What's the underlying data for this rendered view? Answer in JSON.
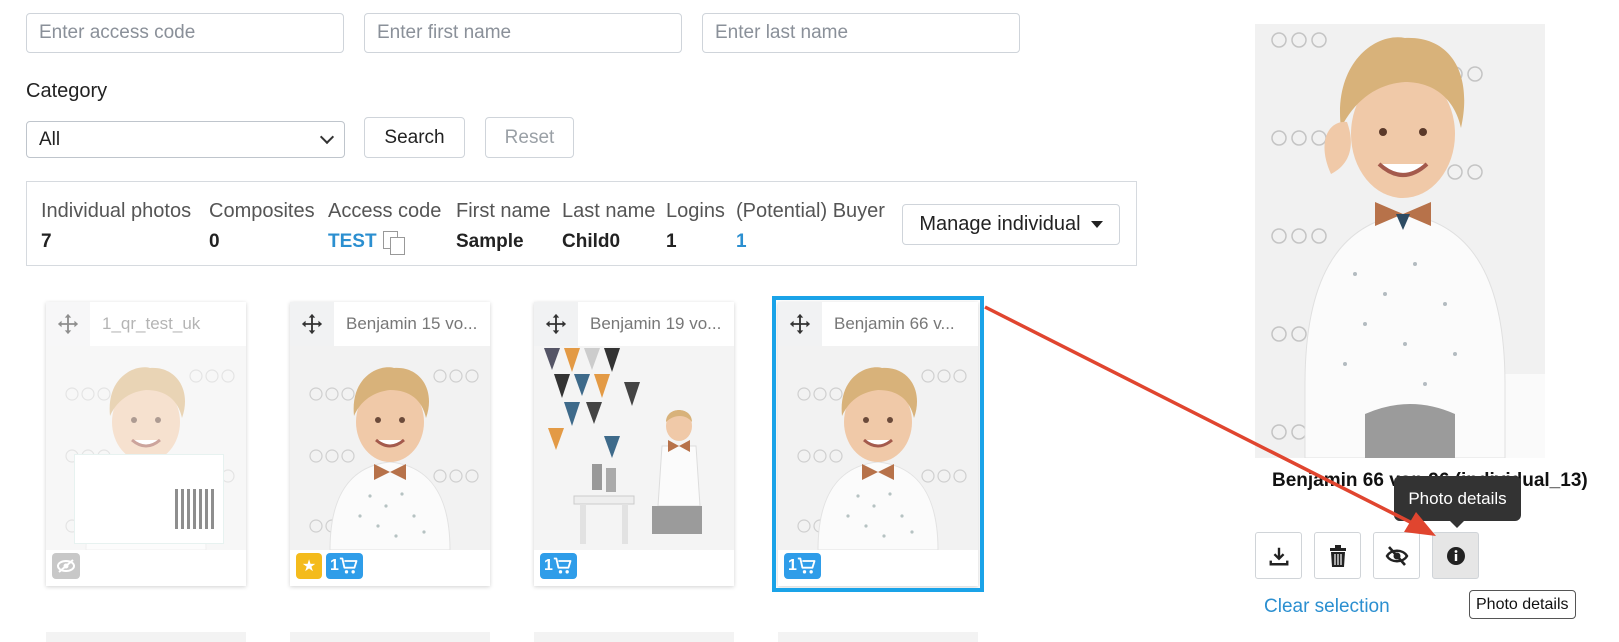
{
  "filters": {
    "access_code_placeholder": "Enter access code",
    "first_name_placeholder": "Enter first name",
    "last_name_placeholder": "Enter last name",
    "category_label": "Category",
    "category_value": "All",
    "search_label": "Search",
    "reset_label": "Reset"
  },
  "info": {
    "columns": [
      {
        "header": "Individual photos",
        "value": "7"
      },
      {
        "header": "Composites",
        "value": "0"
      },
      {
        "header": "Access code",
        "value": "TEST"
      },
      {
        "header": "First name",
        "value": "Sample"
      },
      {
        "header": "Last name",
        "value": "Child0"
      },
      {
        "header": "Logins",
        "value": "1"
      },
      {
        "header": "(Potential) Buyer",
        "value": "1"
      }
    ],
    "manage_label": "Manage individual"
  },
  "cards": [
    {
      "name": "1_qr_test_uk",
      "badges": [
        "hidden-icon"
      ]
    },
    {
      "name": "Benjamin 15 vo...",
      "cart_count": "1"
    },
    {
      "name": "Benjamin 19 vo...",
      "cart_count": "1"
    },
    {
      "name": "Benjamin 66 v...",
      "cart_count": "1"
    }
  ],
  "preview": {
    "title": "Benjamin 66 von 96 (individual_13)",
    "tooltip": "Photo details",
    "clear_selection": "Clear selection",
    "tooltip_native": "Photo details",
    "actions": [
      "download-icon",
      "trash-icon",
      "eye-slash-icon",
      "info-icon"
    ]
  },
  "colors": {
    "accent": "#2b8fd0",
    "selected_border": "#1aa3e8",
    "cart_badge": "#2f9de9",
    "star_badge": "#f4bb1c",
    "arrow": "#e0452f"
  }
}
